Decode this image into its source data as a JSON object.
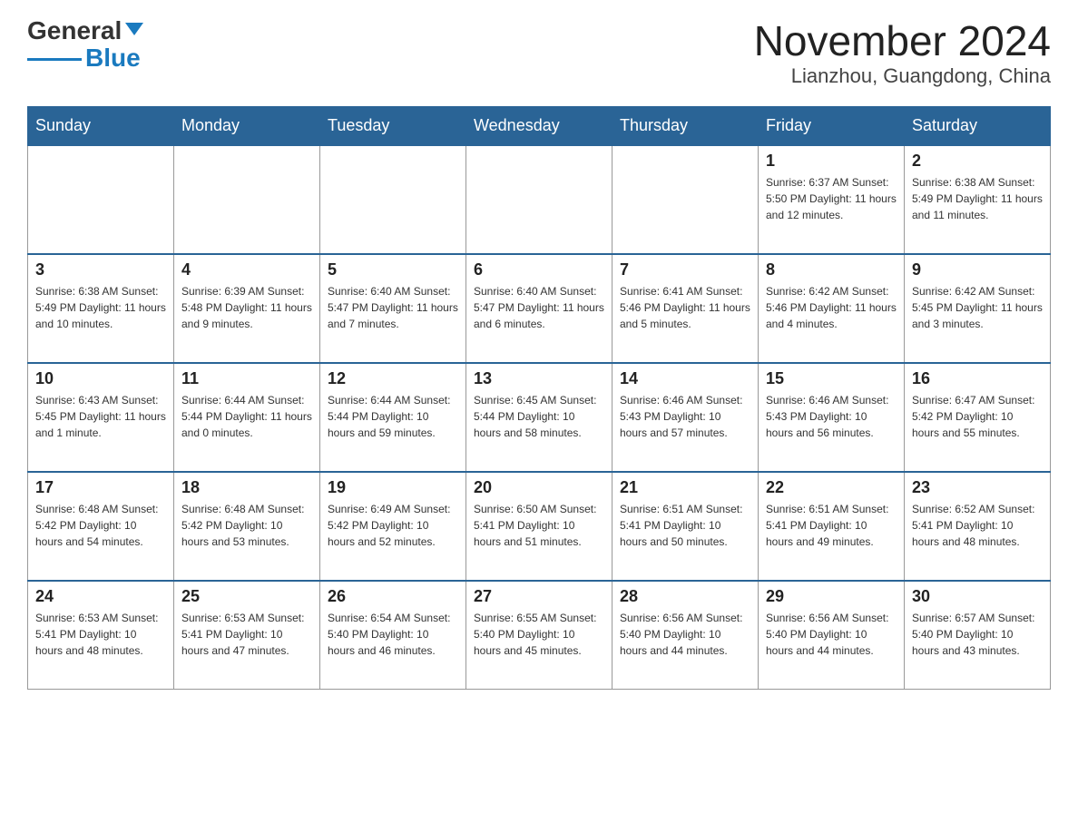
{
  "header": {
    "logo_general": "General",
    "logo_blue": "Blue",
    "month_title": "November 2024",
    "location": "Lianzhou, Guangdong, China"
  },
  "weekdays": [
    "Sunday",
    "Monday",
    "Tuesday",
    "Wednesday",
    "Thursday",
    "Friday",
    "Saturday"
  ],
  "weeks": [
    [
      {
        "day": "",
        "info": ""
      },
      {
        "day": "",
        "info": ""
      },
      {
        "day": "",
        "info": ""
      },
      {
        "day": "",
        "info": ""
      },
      {
        "day": "",
        "info": ""
      },
      {
        "day": "1",
        "info": "Sunrise: 6:37 AM\nSunset: 5:50 PM\nDaylight: 11 hours\nand 12 minutes."
      },
      {
        "day": "2",
        "info": "Sunrise: 6:38 AM\nSunset: 5:49 PM\nDaylight: 11 hours\nand 11 minutes."
      }
    ],
    [
      {
        "day": "3",
        "info": "Sunrise: 6:38 AM\nSunset: 5:49 PM\nDaylight: 11 hours\nand 10 minutes."
      },
      {
        "day": "4",
        "info": "Sunrise: 6:39 AM\nSunset: 5:48 PM\nDaylight: 11 hours\nand 9 minutes."
      },
      {
        "day": "5",
        "info": "Sunrise: 6:40 AM\nSunset: 5:47 PM\nDaylight: 11 hours\nand 7 minutes."
      },
      {
        "day": "6",
        "info": "Sunrise: 6:40 AM\nSunset: 5:47 PM\nDaylight: 11 hours\nand 6 minutes."
      },
      {
        "day": "7",
        "info": "Sunrise: 6:41 AM\nSunset: 5:46 PM\nDaylight: 11 hours\nand 5 minutes."
      },
      {
        "day": "8",
        "info": "Sunrise: 6:42 AM\nSunset: 5:46 PM\nDaylight: 11 hours\nand 4 minutes."
      },
      {
        "day": "9",
        "info": "Sunrise: 6:42 AM\nSunset: 5:45 PM\nDaylight: 11 hours\nand 3 minutes."
      }
    ],
    [
      {
        "day": "10",
        "info": "Sunrise: 6:43 AM\nSunset: 5:45 PM\nDaylight: 11 hours\nand 1 minute."
      },
      {
        "day": "11",
        "info": "Sunrise: 6:44 AM\nSunset: 5:44 PM\nDaylight: 11 hours\nand 0 minutes."
      },
      {
        "day": "12",
        "info": "Sunrise: 6:44 AM\nSunset: 5:44 PM\nDaylight: 10 hours\nand 59 minutes."
      },
      {
        "day": "13",
        "info": "Sunrise: 6:45 AM\nSunset: 5:44 PM\nDaylight: 10 hours\nand 58 minutes."
      },
      {
        "day": "14",
        "info": "Sunrise: 6:46 AM\nSunset: 5:43 PM\nDaylight: 10 hours\nand 57 minutes."
      },
      {
        "day": "15",
        "info": "Sunrise: 6:46 AM\nSunset: 5:43 PM\nDaylight: 10 hours\nand 56 minutes."
      },
      {
        "day": "16",
        "info": "Sunrise: 6:47 AM\nSunset: 5:42 PM\nDaylight: 10 hours\nand 55 minutes."
      }
    ],
    [
      {
        "day": "17",
        "info": "Sunrise: 6:48 AM\nSunset: 5:42 PM\nDaylight: 10 hours\nand 54 minutes."
      },
      {
        "day": "18",
        "info": "Sunrise: 6:48 AM\nSunset: 5:42 PM\nDaylight: 10 hours\nand 53 minutes."
      },
      {
        "day": "19",
        "info": "Sunrise: 6:49 AM\nSunset: 5:42 PM\nDaylight: 10 hours\nand 52 minutes."
      },
      {
        "day": "20",
        "info": "Sunrise: 6:50 AM\nSunset: 5:41 PM\nDaylight: 10 hours\nand 51 minutes."
      },
      {
        "day": "21",
        "info": "Sunrise: 6:51 AM\nSunset: 5:41 PM\nDaylight: 10 hours\nand 50 minutes."
      },
      {
        "day": "22",
        "info": "Sunrise: 6:51 AM\nSunset: 5:41 PM\nDaylight: 10 hours\nand 49 minutes."
      },
      {
        "day": "23",
        "info": "Sunrise: 6:52 AM\nSunset: 5:41 PM\nDaylight: 10 hours\nand 48 minutes."
      }
    ],
    [
      {
        "day": "24",
        "info": "Sunrise: 6:53 AM\nSunset: 5:41 PM\nDaylight: 10 hours\nand 48 minutes."
      },
      {
        "day": "25",
        "info": "Sunrise: 6:53 AM\nSunset: 5:41 PM\nDaylight: 10 hours\nand 47 minutes."
      },
      {
        "day": "26",
        "info": "Sunrise: 6:54 AM\nSunset: 5:40 PM\nDaylight: 10 hours\nand 46 minutes."
      },
      {
        "day": "27",
        "info": "Sunrise: 6:55 AM\nSunset: 5:40 PM\nDaylight: 10 hours\nand 45 minutes."
      },
      {
        "day": "28",
        "info": "Sunrise: 6:56 AM\nSunset: 5:40 PM\nDaylight: 10 hours\nand 44 minutes."
      },
      {
        "day": "29",
        "info": "Sunrise: 6:56 AM\nSunset: 5:40 PM\nDaylight: 10 hours\nand 44 minutes."
      },
      {
        "day": "30",
        "info": "Sunrise: 6:57 AM\nSunset: 5:40 PM\nDaylight: 10 hours\nand 43 minutes."
      }
    ]
  ]
}
